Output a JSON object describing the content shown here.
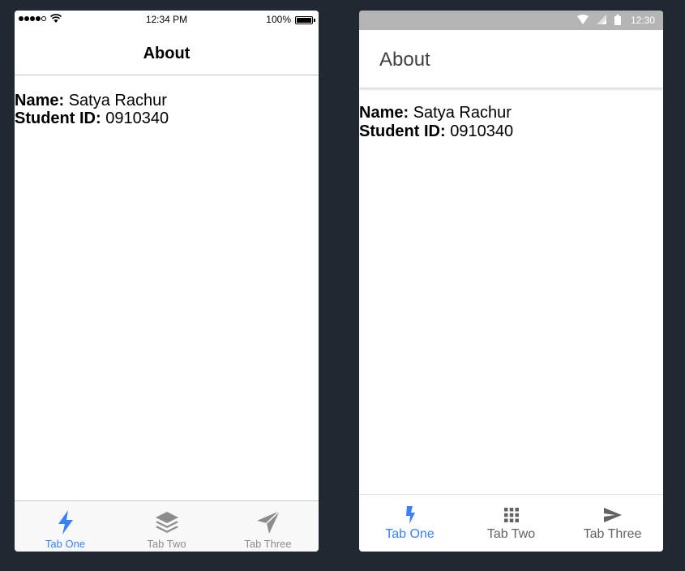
{
  "ios": {
    "status": {
      "time": "12:34 PM",
      "battery": "100%"
    },
    "title": "About",
    "profile": {
      "name_label": "Name:",
      "name_value": "Satya Rachur",
      "id_label": "Student ID:",
      "id_value": "0910340"
    },
    "tabs": [
      {
        "label": "Tab One",
        "icon": "flash-icon",
        "active": true
      },
      {
        "label": "Tab Two",
        "icon": "layers-icon",
        "active": false
      },
      {
        "label": "Tab Three",
        "icon": "send-icon",
        "active": false
      }
    ]
  },
  "android": {
    "status": {
      "time": "12:30"
    },
    "title": "About",
    "profile": {
      "name_label": "Name:",
      "name_value": "Satya Rachur",
      "id_label": "Student ID:",
      "id_value": "0910340"
    },
    "tabs": [
      {
        "label": "Tab One",
        "icon": "flash-icon",
        "active": true
      },
      {
        "label": "Tab Two",
        "icon": "grid-icon",
        "active": false
      },
      {
        "label": "Tab Three",
        "icon": "send-icon",
        "active": false
      }
    ]
  },
  "colors": {
    "accent": "#3880ff",
    "inactive": "#8c8c8c",
    "background": "#222831"
  }
}
